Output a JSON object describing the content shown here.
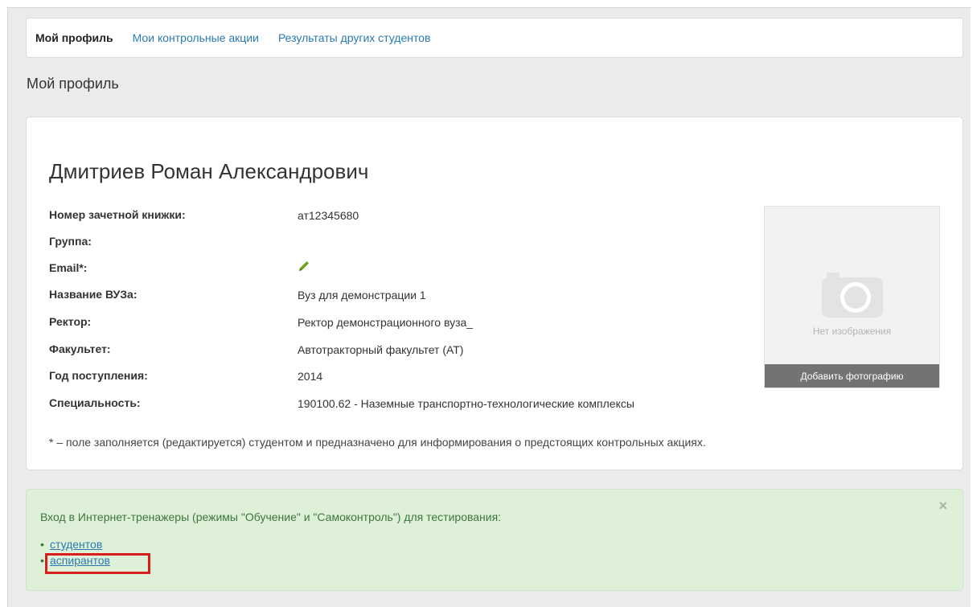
{
  "nav": {
    "tabs": [
      {
        "label": "Мой профиль",
        "active": true
      },
      {
        "label": "Мои контрольные акции",
        "active": false
      },
      {
        "label": "Результаты других студентов",
        "active": false
      }
    ]
  },
  "page_title": "Мой профиль",
  "profile": {
    "name": "Дмитриев Роман Александрович",
    "fields": [
      {
        "label": "Номер зачетной книжки:",
        "value": "ат12345680"
      },
      {
        "label": "Группа:",
        "value": ""
      },
      {
        "label": "Email*:",
        "value": "",
        "icon": "pencil-edit-icon"
      },
      {
        "label": "Название ВУЗа:",
        "value": "Вуз для демонстрации 1"
      },
      {
        "label": "Ректор:",
        "value": "Ректор демонстрационного вуза_"
      },
      {
        "label": "Факультет:",
        "value": "Автотракторный факультет (АТ)"
      },
      {
        "label": "Год поступления:",
        "value": "2014"
      },
      {
        "label": "Специальность:",
        "value": "190100.62 - Наземные транспортно-технологические комплексы"
      }
    ],
    "footnote": "* – поле заполняется (редактируется) студентом и предназначено для информирования о предстоящих контрольных акциях.",
    "photo": {
      "placeholder_text": "Нет изображения",
      "add_button": "Добавить фотографию",
      "icon": "camera-icon"
    }
  },
  "alert": {
    "text": "Вход в Интернет-тренажеры (режимы \"Обучение\" и \"Самоконтроль\") для тестирования:",
    "close": "×",
    "bullet": "•",
    "links": [
      "студентов",
      "аспирантов"
    ],
    "highlighted_link_index": 1,
    "highlight_color": "#d81d1d"
  },
  "colors": {
    "link": "#2a7ab0",
    "alert_bg": "#dff0d8",
    "alert_text": "#3c763d",
    "edit_icon": "#6aa319",
    "photo_button_bg": "#737373"
  }
}
